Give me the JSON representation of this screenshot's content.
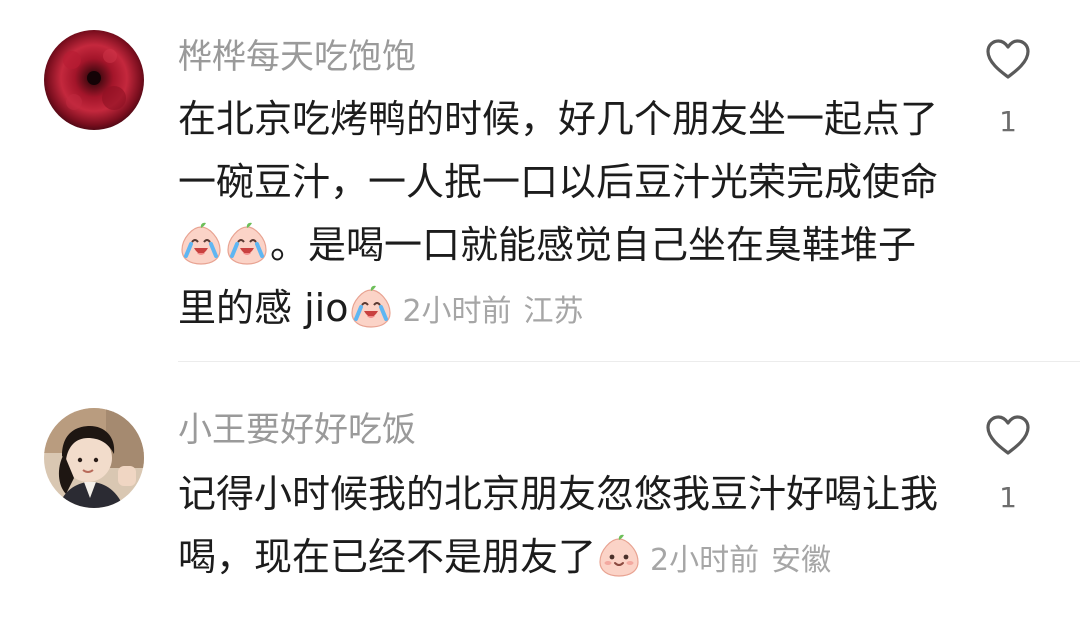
{
  "comments": [
    {
      "username": "桦桦每天吃饱饱",
      "text_segments": [
        "在北京吃烤鸭的时候，好几个朋友坐一起点了一碗豆汁，一人抿一口以后豆汁光荣完成使命",
        "。是喝一口就能感觉自己坐在臭鞋堆子里的感 jio"
      ],
      "emojis": [
        "crying-laughing-peach-emoji",
        "crying-laughing-peach-emoji",
        "crying-laughing-peach-emoji"
      ],
      "time": "2小时前",
      "location": "江苏",
      "likes": "1",
      "icon": "heart-icon"
    },
    {
      "username": "小王要好好吃饭",
      "text_segments": [
        "记得小时候我的北京朋友忽悠我豆汁好喝让我喝，现在已经不是朋友了"
      ],
      "emojis": [
        "smiling-peach-emoji"
      ],
      "time": "2小时前",
      "location": "安徽",
      "likes": "1",
      "icon": "heart-icon"
    }
  ],
  "colors": {
    "username": "#9a9a9a",
    "text": "#1c1c1c",
    "meta": "#a6a6a6",
    "like": "#6d6d6d",
    "divider": "#ececec"
  }
}
